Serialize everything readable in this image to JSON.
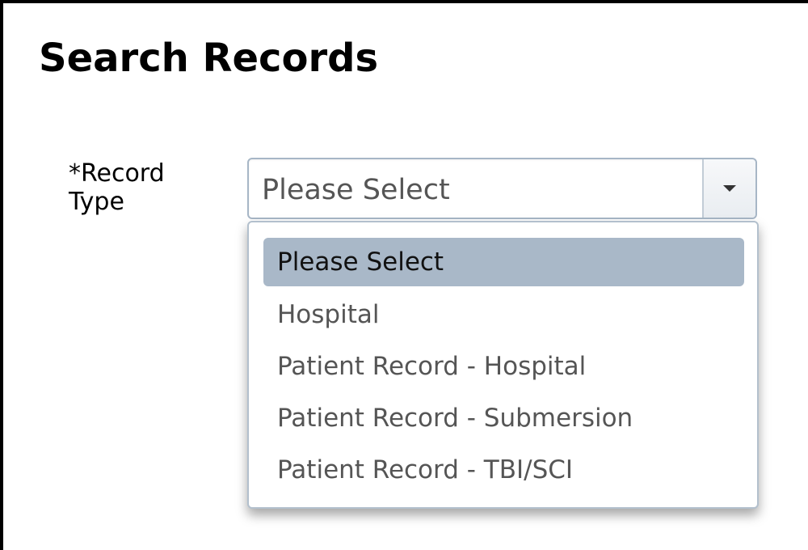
{
  "page": {
    "title": "Search Records"
  },
  "form": {
    "record_type": {
      "label": "*Record Type",
      "selected_value": "Please Select",
      "options": [
        "Please Select",
        "Hospital",
        "Patient Record - Hospital",
        "Patient Record - Submersion",
        "Patient Record - TBI/SCI"
      ],
      "highlighted_index": 0,
      "dropdown_icon": "caret-down-icon"
    }
  },
  "colors": {
    "highlight": "#a9b8c8",
    "border": "#a7b6c6",
    "option_text": "#555555"
  }
}
